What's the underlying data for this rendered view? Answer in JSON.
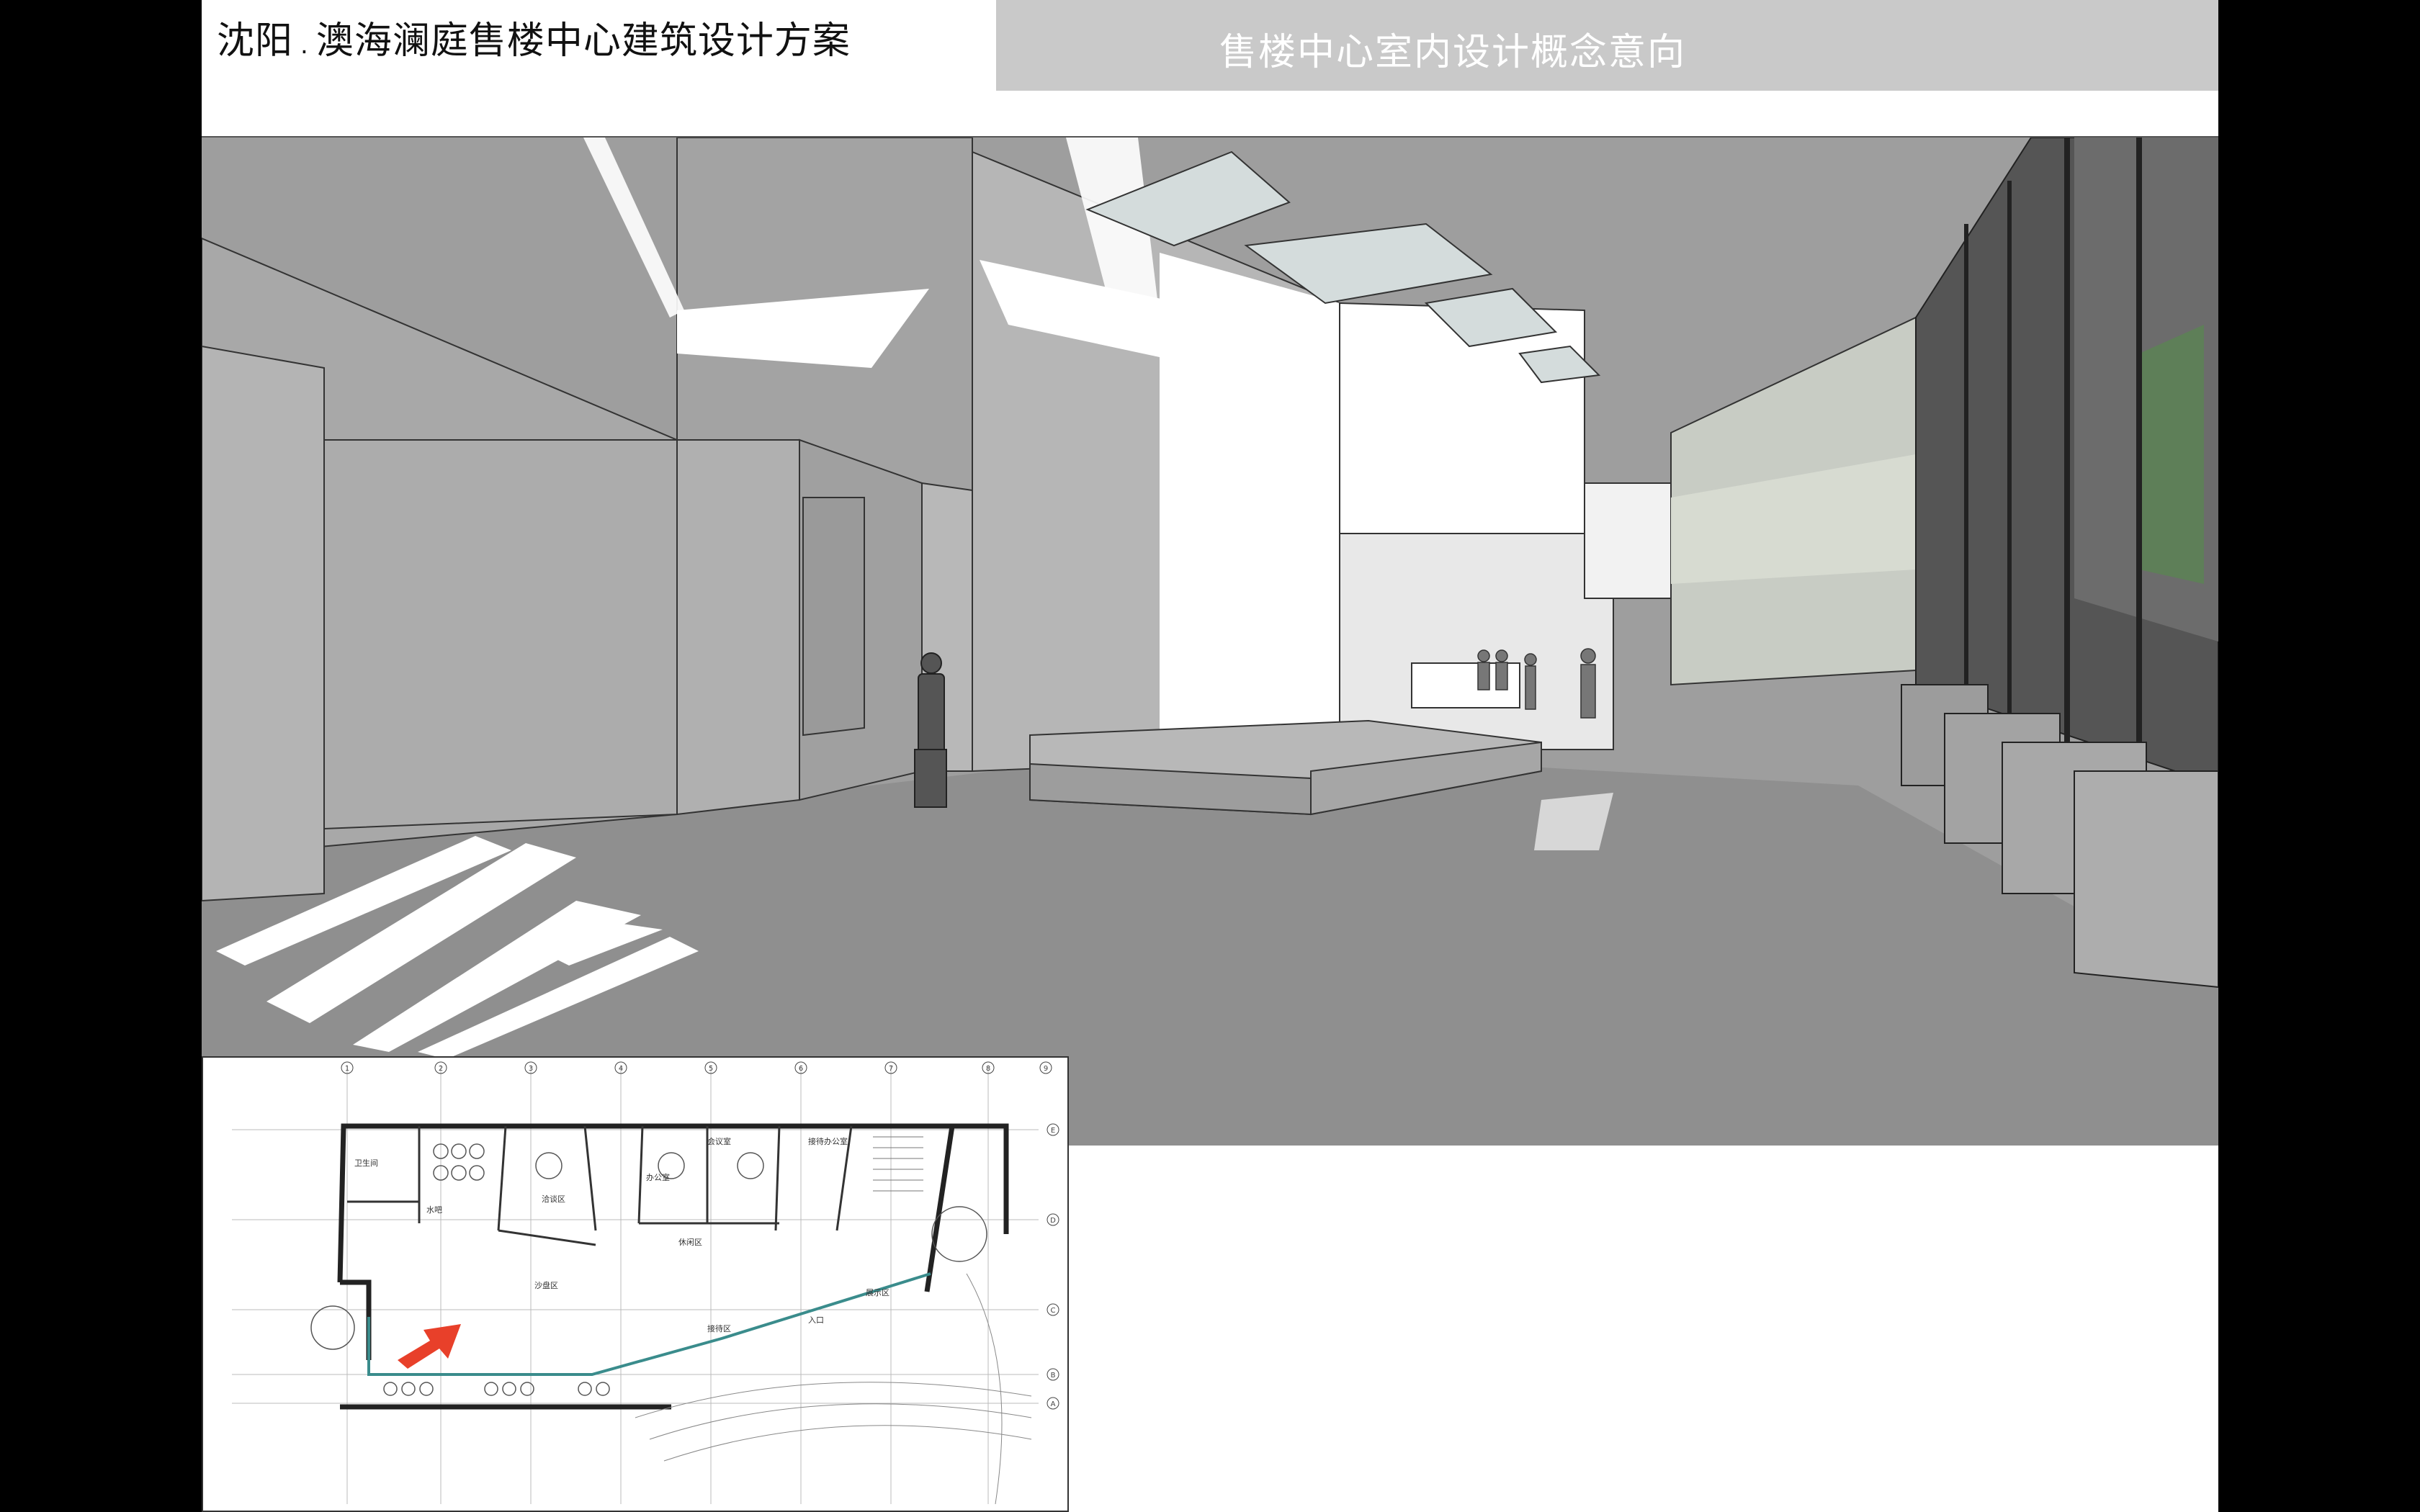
{
  "header": {
    "title_city": "沈阳",
    "title_sep": ".",
    "title_project": "澳海澜庭售楼中心建筑设计方案",
    "section_title": "售楼中心室内设计概念意向"
  },
  "rendering": {
    "image": "interior-perspective-rendering"
  },
  "floor_plan": {
    "image": "floor-plan-drawing",
    "arrow_color": "#e8402a",
    "room_labels": [
      "洽谈区",
      "办公室",
      "接待办公室",
      "会议室",
      "卫生间",
      "水吧",
      "沙盘区",
      "入口",
      "接待区",
      "休闲区",
      "展示区"
    ],
    "grid_numbers": [
      "1",
      "2",
      "3",
      "4",
      "5",
      "6",
      "7",
      "8",
      "9"
    ],
    "grid_letters": [
      "A",
      "B",
      "C",
      "D",
      "E"
    ]
  },
  "colors": {
    "background": "#000000",
    "header_band": "#c9c9c9",
    "render_floor": "#8f8f8f",
    "render_wall": "#bdbdbd"
  }
}
